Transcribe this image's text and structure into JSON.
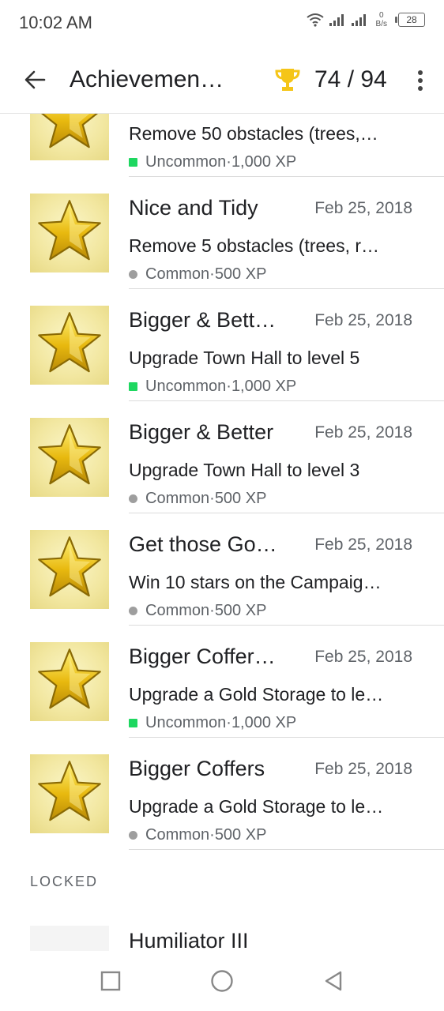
{
  "status_bar": {
    "time": "10:02 AM",
    "net_speed_value": "0",
    "net_speed_unit": "B/s",
    "battery": "28",
    "icons": [
      "wifi-icon",
      "signal-icon",
      "signal-icon",
      "battery-icon"
    ]
  },
  "app_bar": {
    "title": "Achievemen…",
    "trophy_icon": "trophy-icon",
    "count": "74 / 94",
    "trophy_color": "#f5c518"
  },
  "achievements": [
    {
      "title": "",
      "date": "",
      "description": "Remove 50 obstacles (trees,…",
      "rarity": "Uncommon",
      "xp": "1,000 XP",
      "rarity_color": "#1ed760"
    },
    {
      "title": "Nice and Tidy",
      "date": "Feb 25, 2018",
      "description": "Remove 5 obstacles (trees, r…",
      "rarity": "Common",
      "xp": "500 XP",
      "rarity_color": "#9e9e9e"
    },
    {
      "title": "Bigger & Bett…",
      "date": "Feb 25, 2018",
      "description": "Upgrade Town Hall to level 5",
      "rarity": "Uncommon",
      "xp": "1,000 XP",
      "rarity_color": "#1ed760"
    },
    {
      "title": "Bigger & Better",
      "date": "Feb 25, 2018",
      "description": "Upgrade Town Hall to level 3",
      "rarity": "Common",
      "xp": "500 XP",
      "rarity_color": "#9e9e9e"
    },
    {
      "title": "Get those Go…",
      "date": "Feb 25, 2018",
      "description": "Win 10 stars on the Campaig…",
      "rarity": "Common",
      "xp": "500 XP",
      "rarity_color": "#9e9e9e"
    },
    {
      "title": "Bigger Coffer…",
      "date": "Feb 25, 2018",
      "description": "Upgrade a Gold Storage to le…",
      "rarity": "Uncommon",
      "xp": "1,000 XP",
      "rarity_color": "#1ed760"
    },
    {
      "title": "Bigger Coffers",
      "date": "Feb 25, 2018",
      "description": "Upgrade a Gold Storage to le…",
      "rarity": "Common",
      "xp": "500 XP",
      "rarity_color": "#9e9e9e"
    }
  ],
  "meta_separator": " · ",
  "locked_section": {
    "header": "LOCKED",
    "items": [
      {
        "title": "Humiliator III"
      }
    ]
  },
  "nav_bar": {
    "icons": [
      "recent-apps-icon",
      "home-icon",
      "back-icon"
    ]
  }
}
